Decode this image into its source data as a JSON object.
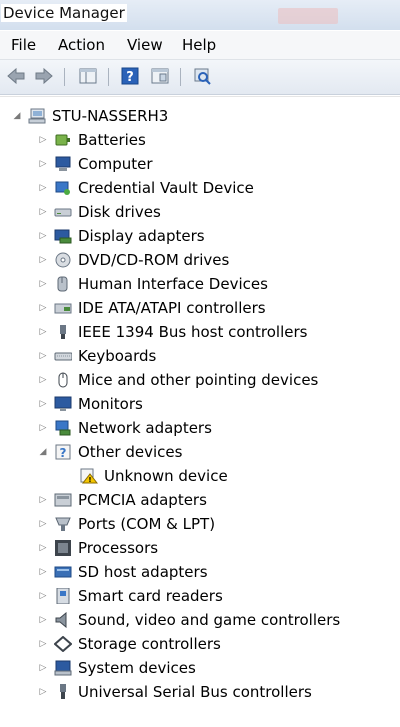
{
  "window": {
    "title": "Device Manager"
  },
  "menu": [
    "File",
    "Action",
    "View",
    "Help"
  ],
  "toolbar": {
    "buttons": [
      "back-arrow-icon",
      "forward-arrow-icon",
      "show-hide-tree-icon",
      "help-icon",
      "properties-icon",
      "scan-hardware-icon"
    ]
  },
  "tree": {
    "root": "STU-NASSERH3",
    "items": [
      {
        "label": "Batteries",
        "icon": "battery-icon",
        "expanded": false
      },
      {
        "label": "Computer",
        "icon": "computer-icon",
        "expanded": false
      },
      {
        "label": "Credential Vault Device",
        "icon": "credential-icon",
        "expanded": false
      },
      {
        "label": "Disk drives",
        "icon": "disk-drive-icon",
        "expanded": false
      },
      {
        "label": "Display adapters",
        "icon": "display-adapter-icon",
        "expanded": false
      },
      {
        "label": "DVD/CD-ROM drives",
        "icon": "dvd-drive-icon",
        "expanded": false
      },
      {
        "label": "Human Interface Devices",
        "icon": "hid-icon",
        "expanded": false
      },
      {
        "label": "IDE ATA/ATAPI controllers",
        "icon": "ide-controller-icon",
        "expanded": false
      },
      {
        "label": "IEEE 1394 Bus host controllers",
        "icon": "ieee1394-icon",
        "expanded": false
      },
      {
        "label": "Keyboards",
        "icon": "keyboard-icon",
        "expanded": false
      },
      {
        "label": "Mice and other pointing devices",
        "icon": "mouse-icon",
        "expanded": false
      },
      {
        "label": "Monitors",
        "icon": "monitor-icon",
        "expanded": false
      },
      {
        "label": "Network adapters",
        "icon": "network-adapter-icon",
        "expanded": false
      },
      {
        "label": "Other devices",
        "icon": "other-devices-icon",
        "expanded": true,
        "children": [
          {
            "label": "Unknown device",
            "icon": "warning-device-icon"
          }
        ]
      },
      {
        "label": "PCMCIA adapters",
        "icon": "pcmcia-icon",
        "expanded": false
      },
      {
        "label": "Ports (COM & LPT)",
        "icon": "ports-icon",
        "expanded": false
      },
      {
        "label": "Processors",
        "icon": "processor-icon",
        "expanded": false
      },
      {
        "label": "SD host adapters",
        "icon": "sd-host-icon",
        "expanded": false
      },
      {
        "label": "Smart card readers",
        "icon": "smart-card-icon",
        "expanded": false
      },
      {
        "label": "Sound, video and game controllers",
        "icon": "sound-icon",
        "expanded": false
      },
      {
        "label": "Storage controllers",
        "icon": "storage-controller-icon",
        "expanded": false
      },
      {
        "label": "System devices",
        "icon": "system-devices-icon",
        "expanded": false
      },
      {
        "label": "Universal Serial Bus controllers",
        "icon": "usb-icon",
        "expanded": false
      }
    ]
  }
}
